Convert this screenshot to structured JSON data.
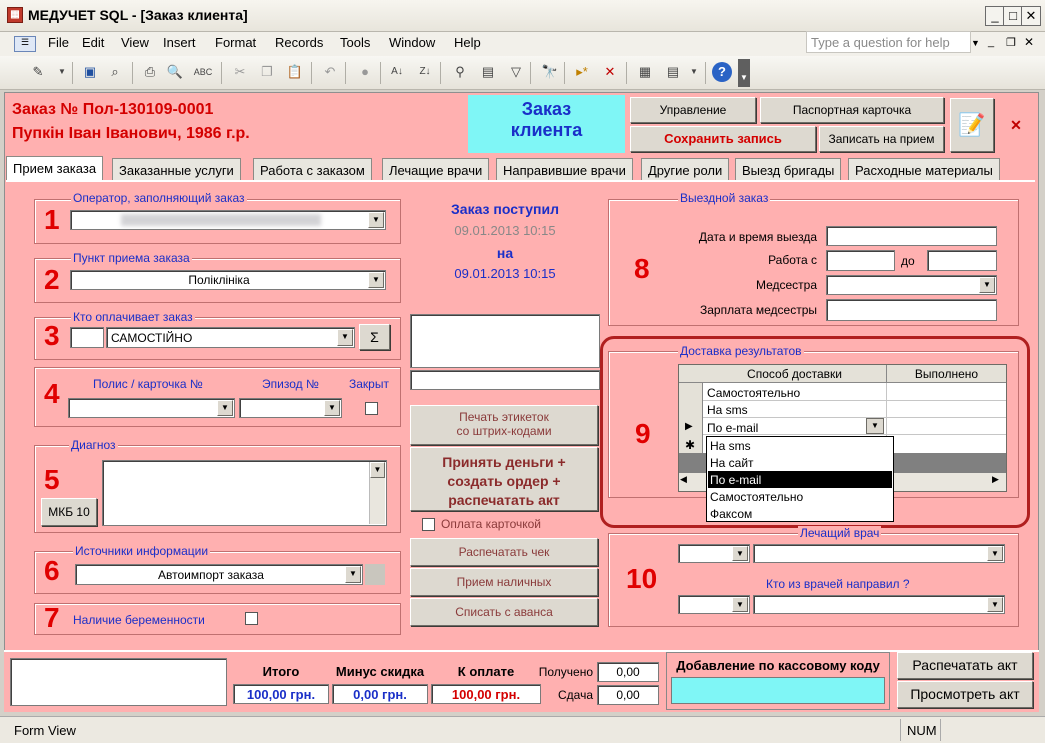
{
  "window": {
    "title": "МЕДУЧЕТ SQL - [Заказ клиента]",
    "app_icon": "table-doc-icon"
  },
  "menu": [
    "File",
    "Edit",
    "View",
    "Insert",
    "Format",
    "Records",
    "Tools",
    "Window",
    "Help"
  ],
  "help_placeholder": "Type a question for help",
  "header": {
    "order_no": "Заказ №  Пол-130109-0001",
    "patient": "Пупкін Іван Іванович, 1986 г.р.",
    "form_title_1": "Заказ",
    "form_title_2": "клиента",
    "btn_manage": "Управление",
    "btn_passport": "Паспортная карточка",
    "btn_save": "Сохранить запись",
    "btn_appt": "Записать на прием"
  },
  "tabs": [
    "Прием заказа",
    "Заказанные услуги",
    "Работа с заказом",
    "Лечащие врачи",
    "Направившие врачи",
    "Другие роли",
    "Выезд бригады",
    "Расходные материалы"
  ],
  "left": {
    "operator_label": "Оператор, заполняющий заказ",
    "point_label": "Пункт приема заказа",
    "point_value": "Поліклініка",
    "payer_label": "Кто оплачивает заказ",
    "payer_value": "САМОСТІЙНО",
    "sum_btn": "Σ",
    "policy_label": "Полис / карточка №",
    "episode_label": "Эпизод №",
    "closed_label": "Закрыт",
    "diagnosis_label": "Диагноз",
    "mkb_btn": "МКБ 10",
    "sources_label": "Источники информации",
    "sources_value": "Автоимпорт заказа",
    "pregnancy_label": "Наличие беременности"
  },
  "center": {
    "received_label": "Заказ поступил",
    "received_dt": "09.01.2013 10:15",
    "on_label": "на",
    "on_dt": "09.01.2013 10:15",
    "print_labels_1": "Печать этикеток",
    "print_labels_2": "со штрих-кодами",
    "accept_money_1": "Принять деньги +",
    "accept_money_2": "создать ордер +",
    "accept_money_3": "распечатать акт",
    "pay_card": "Оплата карточкой",
    "print_check": "Распечатать чек",
    "cash_receipt": "Прием наличных",
    "write_off": "Списать с аванса"
  },
  "right": {
    "visit_label": "Выездной заказ",
    "visit_dt_label": "Дата и время выезда",
    "work_from": "Работа с",
    "to": "до",
    "nurse": "Медсестра",
    "nurse_salary": "Зарплата медсестры",
    "delivery_label": "Доставка результатов",
    "col_method": "Способ доставки",
    "col_done": "Выполнено",
    "rows": [
      "Самостоятельно",
      "На sms",
      "По e-mail"
    ],
    "dropdown": [
      "На sms",
      "На сайт",
      "По e-mail",
      "Самостоятельно",
      "Факсом"
    ],
    "dropdown_selected": 2,
    "doctor_label": "Лечащий врач",
    "referrer_label": "Кто из врачей направил ?"
  },
  "numbers": [
    "1",
    "2",
    "3",
    "4",
    "5",
    "6",
    "7",
    "8",
    "9",
    "10"
  ],
  "footer": {
    "total_label": "Итого",
    "total": "100,00 грн.",
    "discount_label": "Минус скидка",
    "discount": "0,00 грн.",
    "topay_label": "К оплате",
    "topay": "100,00 грн.",
    "received_label": "Получено",
    "received": "0,00",
    "change_label": "Сдача",
    "change": "0,00",
    "cashcode_label": "Добавление по кассовому коду",
    "print_act": "Распечатать акт",
    "view_act": "Просмотреть акт"
  },
  "status": {
    "left": "Form View",
    "num": "NUM"
  }
}
